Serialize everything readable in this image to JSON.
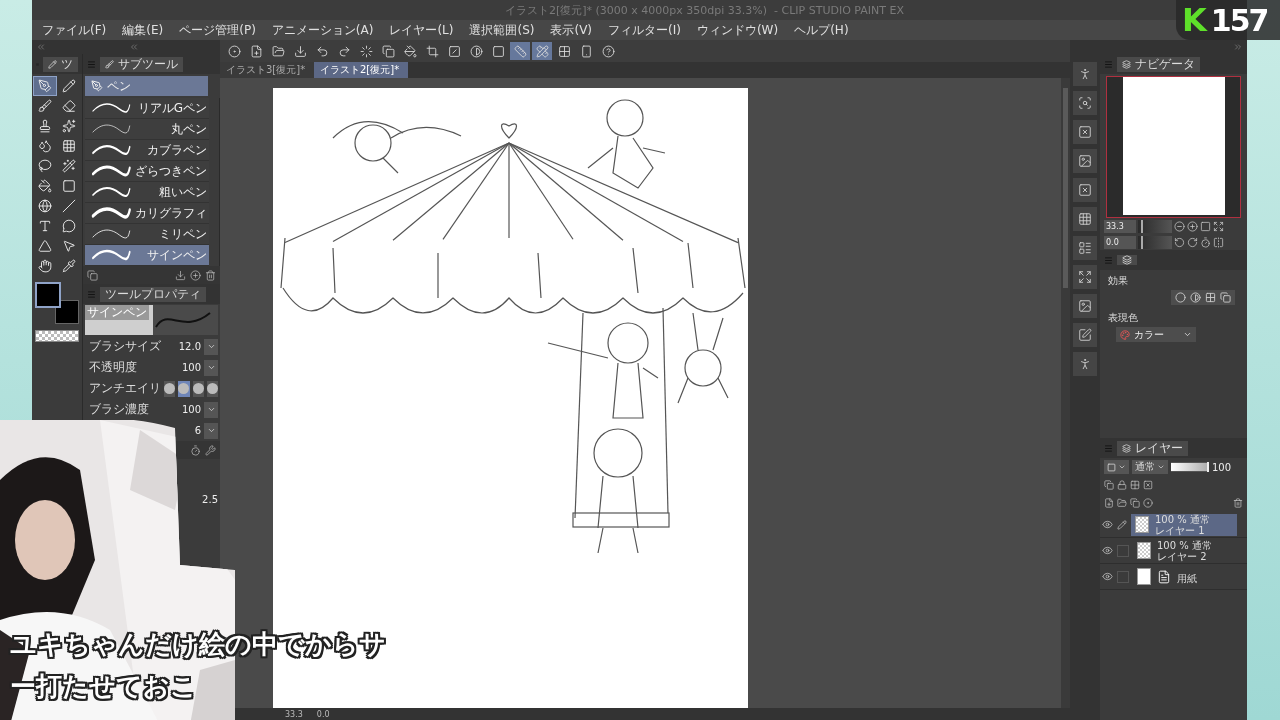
{
  "window": {
    "title": "イラスト2[復元]* (3000 x 4000px 350dpi 33.3%)  - CLIP STUDIO PAINT EX"
  },
  "menu": [
    "ファイル(F)",
    "編集(E)",
    "ページ管理(P)",
    "アニメーション(A)",
    "レイヤー(L)",
    "選択範囲(S)",
    "表示(V)",
    "フィルター(I)",
    "ウィンドウ(W)",
    "ヘルプ(H)"
  ],
  "command_bar": [
    {
      "kind": "app",
      "selected": false
    },
    {
      "kind": "new",
      "selected": false
    },
    {
      "kind": "open",
      "selected": false
    },
    {
      "kind": "export",
      "selected": false
    },
    {
      "kind": "undo",
      "selected": false
    },
    {
      "kind": "redo",
      "selected": false
    },
    {
      "kind": "clear",
      "selected": false
    },
    {
      "kind": "copy",
      "selected": false
    },
    {
      "kind": "fill",
      "selected": false
    },
    {
      "kind": "crop",
      "selected": false
    },
    {
      "kind": "hide",
      "selected": false
    },
    {
      "kind": "invert",
      "selected": false
    },
    {
      "kind": "border",
      "selected": false
    },
    {
      "kind": "snap-ruler",
      "selected": true
    },
    {
      "kind": "snap-special",
      "selected": true
    },
    {
      "kind": "snap-grid",
      "selected": false
    },
    {
      "kind": "device",
      "selected": false
    },
    {
      "kind": "help",
      "selected": false
    }
  ],
  "document_tabs": [
    {
      "label": "イラスト3[復元]*",
      "selected": false
    },
    {
      "label": "イラスト2[復元]*",
      "selected": true
    }
  ],
  "tool_tab": "ツ",
  "tools": [
    {
      "kind": "pen",
      "selected": true
    },
    {
      "kind": "pencil",
      "selected": false
    },
    {
      "kind": "brush",
      "selected": false
    },
    {
      "kind": "eraser",
      "selected": false
    },
    {
      "kind": "stamp",
      "selected": false
    },
    {
      "kind": "sparkle",
      "selected": false
    },
    {
      "kind": "blend",
      "selected": false
    },
    {
      "kind": "grid",
      "selected": false
    },
    {
      "kind": "lasso",
      "selected": false
    },
    {
      "kind": "wand",
      "selected": false
    },
    {
      "kind": "bucket",
      "selected": false
    },
    {
      "kind": "gradient",
      "selected": false
    },
    {
      "kind": "globe",
      "selected": false
    },
    {
      "kind": "line",
      "selected": false
    },
    {
      "kind": "text",
      "selected": false
    },
    {
      "kind": "balloon",
      "selected": false
    },
    {
      "kind": "ruler",
      "selected": false
    },
    {
      "kind": "cursor",
      "selected": false
    },
    {
      "kind": "hand",
      "selected": false
    },
    {
      "kind": "pipette",
      "selected": false
    }
  ],
  "subtool": {
    "tab": "サブツール",
    "group": "ペン",
    "brushes": [
      {
        "label": "リアルGペン",
        "selected": false
      },
      {
        "label": "丸ペン",
        "selected": false
      },
      {
        "label": "カブラペン",
        "selected": false
      },
      {
        "label": "ざらつきペン",
        "selected": false
      },
      {
        "label": "粗いペン",
        "selected": false
      },
      {
        "label": "カリグラフィ",
        "selected": false
      },
      {
        "label": "ミリペン",
        "selected": false
      },
      {
        "label": "サインペン",
        "selected": true
      }
    ]
  },
  "tool_property": {
    "tab": "ツールプロパティ",
    "preview_label": "サインペン",
    "rows": [
      {
        "kind": "number",
        "label": "ブラシサイズ",
        "value": "12.0"
      },
      {
        "kind": "number",
        "label": "不透明度",
        "value": "100"
      },
      {
        "kind": "antialias",
        "label": "アンチエイリ",
        "options": [
          {
            "selected": false
          },
          {
            "selected": true
          },
          {
            "selected": false
          },
          {
            "selected": false
          }
        ]
      },
      {
        "kind": "number",
        "label": "ブラシ濃度",
        "value": "100"
      },
      {
        "kind": "number",
        "value": "6"
      }
    ],
    "lower_value": "2.5"
  },
  "navigator": {
    "tab": "ナビゲータ",
    "zoom": "33.3",
    "zoom_slider": {
      "level": 0.08
    },
    "angle": "0.0",
    "angle_slider": {
      "level": 0.08
    }
  },
  "layer_property": {
    "effect_label": "効果",
    "color_label": "表現色",
    "color_mode": "カラー"
  },
  "layers_panel": {
    "tab": "レイヤー",
    "blend": "通常",
    "opacity": "100",
    "opacity_slider": {
      "level": 1
    },
    "layers": [
      {
        "kind": "raster",
        "mode": "100 % 通常",
        "name": "レイヤー 1",
        "selected": true,
        "editing": true
      },
      {
        "kind": "raster",
        "mode": "100 % 通常",
        "name": "レイヤー 2",
        "selected": false,
        "editing": false
      },
      {
        "kind": "paper",
        "name": "用紙",
        "selected": false,
        "editing": false
      }
    ]
  },
  "status_bar": {
    "zoom": "33.3",
    "angle": "0.0"
  },
  "badge": {
    "letter": "K",
    "count": "157"
  },
  "subtitle": [
    "ユキちゃんだけ絵の中でからサ",
    "ー打たせておこ"
  ],
  "webcam": {
    "kind": "picture"
  }
}
